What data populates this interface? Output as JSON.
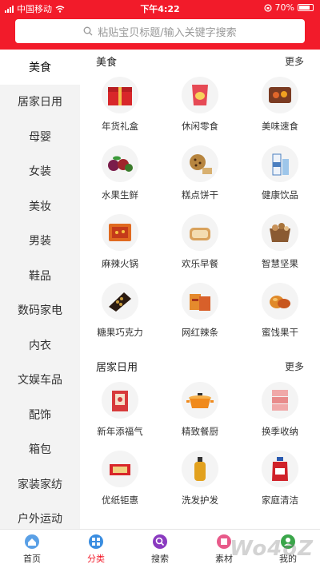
{
  "status_bar": {
    "carrier": "中国移动",
    "time": "下午4:22",
    "battery": "70%"
  },
  "search": {
    "placeholder": "粘贴宝贝标题/输入关键字搜索"
  },
  "sidebar": {
    "items": [
      "美食",
      "居家日用",
      "母婴",
      "女装",
      "美妆",
      "男装",
      "鞋品",
      "数码家电",
      "内衣",
      "文娱车品",
      "配饰",
      "箱包",
      "家装家纺",
      "户外运动"
    ],
    "active_index": 0
  },
  "sections": [
    {
      "title": "美食",
      "more": "更多",
      "items": [
        {
          "label": "年货礼盒",
          "icon": "gift-box-icon",
          "color": "#d8272a"
        },
        {
          "label": "休闲零食",
          "icon": "snack-bag-icon",
          "color": "#e64a55"
        },
        {
          "label": "美味速食",
          "icon": "instant-food-icon",
          "color": "#7a3b22"
        },
        {
          "label": "水果生鲜",
          "icon": "fruit-icon",
          "color": "#7a1c4a"
        },
        {
          "label": "糕点饼干",
          "icon": "cookie-icon",
          "color": "#b7853f"
        },
        {
          "label": "健康饮品",
          "icon": "drink-icon",
          "color": "#4b7fc0"
        },
        {
          "label": "麻辣火锅",
          "icon": "hotpot-icon",
          "color": "#e06a20"
        },
        {
          "label": "欢乐早餐",
          "icon": "bread-icon",
          "color": "#d9a25c"
        },
        {
          "label": "智慧坚果",
          "icon": "nuts-icon",
          "color": "#8a5a32"
        },
        {
          "label": "糖果巧克力",
          "icon": "chocolate-icon",
          "color": "#c79a3c"
        },
        {
          "label": "网红辣条",
          "icon": "spicy-strip-icon",
          "color": "#e58a2c"
        },
        {
          "label": "蜜饯果干",
          "icon": "dried-fruit-icon",
          "color": "#e08a2a"
        }
      ]
    },
    {
      "title": "居家日用",
      "more": "更多",
      "items": [
        {
          "label": "新年添福气",
          "icon": "new-year-icon",
          "color": "#d73a3a"
        },
        {
          "label": "精致餐厨",
          "icon": "cookware-icon",
          "color": "#f08a1c"
        },
        {
          "label": "换季收纳",
          "icon": "storage-icon",
          "color": "#e88a8a"
        },
        {
          "label": "优纸钜惠",
          "icon": "tissue-icon",
          "color": "#d8262a"
        },
        {
          "label": "洗发护发",
          "icon": "shampoo-icon",
          "color": "#e2a11e"
        },
        {
          "label": "家庭清洁",
          "icon": "detergent-icon",
          "color": "#d0222a"
        }
      ]
    }
  ],
  "tabbar": {
    "items": [
      {
        "label": "首页",
        "icon": "home-icon",
        "color": "#5aa0e6"
      },
      {
        "label": "分类",
        "icon": "category-icon",
        "color": "#3a8de0"
      },
      {
        "label": "搜索",
        "icon": "search-icon",
        "color": "#8a3ac0"
      },
      {
        "label": "素材",
        "icon": "material-icon",
        "color": "#e85a8a"
      },
      {
        "label": "我的",
        "icon": "user-icon",
        "color": "#3aa64a"
      }
    ],
    "active_index": 1
  },
  "watermark": "Wo4oZ"
}
